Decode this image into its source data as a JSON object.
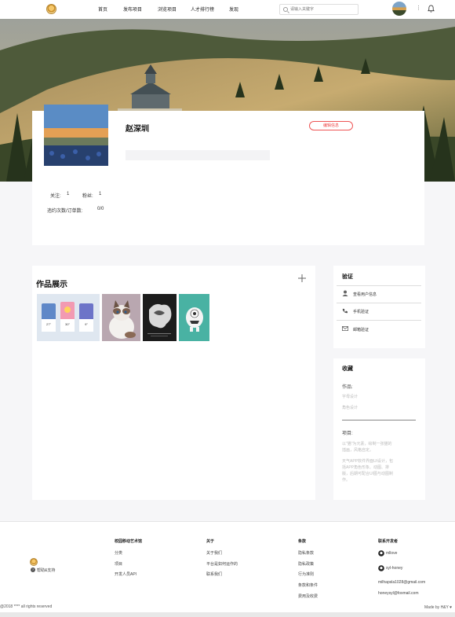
{
  "nav": {
    "links": [
      "首页",
      "发布项目",
      "浏览项目",
      "人才排行榜",
      "发现"
    ],
    "search_placeholder": "请输入关键字",
    "more": "⋮"
  },
  "profile": {
    "name": "赵深圳",
    "edit_label": "编辑信息",
    "follow_label": "关注:",
    "follow_count": "1",
    "fans_label": "粉丝:",
    "fans_count": "1",
    "violations_label": "违约次数/订单数:",
    "violations_value": "0/0"
  },
  "works": {
    "title": "作品展示",
    "items": [
      {
        "icon": "weather-app-thumbnail",
        "temps": [
          "27°",
          "30°",
          "9°"
        ]
      },
      {
        "icon": "cat-illustration-thumbnail"
      },
      {
        "icon": "dark-poster-thumbnail"
      },
      {
        "icon": "monster-character-thumbnail"
      }
    ]
  },
  "verify": {
    "title": "验证",
    "items": [
      "查看用户信息",
      "手机验证",
      "邮箱验证"
    ]
  },
  "favorites": {
    "title": "收藏",
    "works_label": "作品:",
    "works_items": [
      "字母设计",
      "角色设计"
    ],
    "projects_label": "项目:",
    "projects_lines_1": [
      "以\"猫\"为元素，绘制一张猫的",
      "插画，风格自定。"
    ],
    "projects_lines_2": [
      "天气APP软件界面UI设计，包",
      "括APP角色形象、动图、排",
      "版，后期可配合UI图与动图制",
      "作。"
    ]
  },
  "footer": {
    "help_label": "帮助&支持",
    "columns": [
      {
        "head": "校园移动艺术馆",
        "items": [
          "分类",
          "项目",
          "开发人员API"
        ]
      },
      {
        "head": "关于",
        "items": [
          "关于我们",
          "平台是如何运作的",
          "联系我们"
        ]
      },
      {
        "head": "条款",
        "items": [
          "隐私条款",
          "隐私政策",
          "行为准则",
          "条款和条件",
          "费用及收费"
        ]
      },
      {
        "head": "联系开发者",
        "items": [
          "mllove",
          "syl-honey",
          "milhapsla1028@gmail.com",
          "honeysyl@foxmail.com"
        ]
      }
    ],
    "copyright": "@2018 **** all rights reserved",
    "made_by": "Made by H&Y ♥"
  },
  "colors": {
    "accent": "#e44444",
    "background": "#f6f6f8",
    "card": "#ffffff"
  }
}
